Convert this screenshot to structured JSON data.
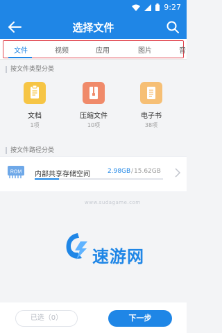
{
  "status_bar": {
    "time": "9:27"
  },
  "app_bar": {
    "title": "选择文件"
  },
  "tabs": [
    {
      "label": "文件",
      "active": true
    },
    {
      "label": "视频",
      "active": false
    },
    {
      "label": "应用",
      "active": false
    },
    {
      "label": "图片",
      "active": false
    },
    {
      "label": "音",
      "active": false
    }
  ],
  "by_type": {
    "section_label": "按文件类型分类",
    "items": [
      {
        "name": "文档",
        "count": "1项",
        "icon": "document-icon",
        "color": "#f6c545"
      },
      {
        "name": "压缩文件",
        "count": "10项",
        "icon": "archive-icon",
        "color": "#f08a6a"
      },
      {
        "name": "电子书",
        "count": "38项",
        "icon": "ebook-icon",
        "color": "#f6bf75"
      }
    ]
  },
  "by_path": {
    "section_label": "按文件路径分类",
    "storage": {
      "icon_label": "ROM",
      "name": "内部共享存储空间",
      "used": "2.98GB",
      "separator": "/",
      "total": "15.62GB",
      "used_fraction": 0.19
    }
  },
  "watermark": {
    "url": "www.sudagame.com",
    "brand": "速游网"
  },
  "bottom_bar": {
    "selected_label": "已选（0）",
    "next_label": "下一步"
  },
  "colors": {
    "primary": "#1f86e6",
    "highlight_outline": "#e0454f"
  }
}
